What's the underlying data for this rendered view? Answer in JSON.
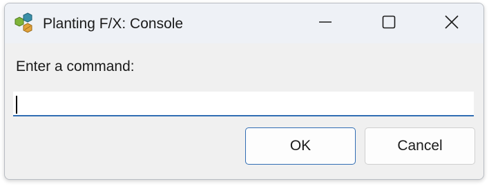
{
  "window": {
    "title": "Planting F/X: Console",
    "app_icon": "planting-fx-hexagons-icon",
    "controls": [
      "minimize-icon",
      "maximize-icon",
      "close-icon"
    ]
  },
  "dialog": {
    "prompt": "Enter a command:",
    "command_input": {
      "value": "",
      "placeholder": ""
    },
    "ok_label": "OK",
    "cancel_label": "Cancel"
  },
  "colors": {
    "accent": "#2f6cb3",
    "titlebar": "#eef1f6",
    "background": "#f0f0f0"
  }
}
